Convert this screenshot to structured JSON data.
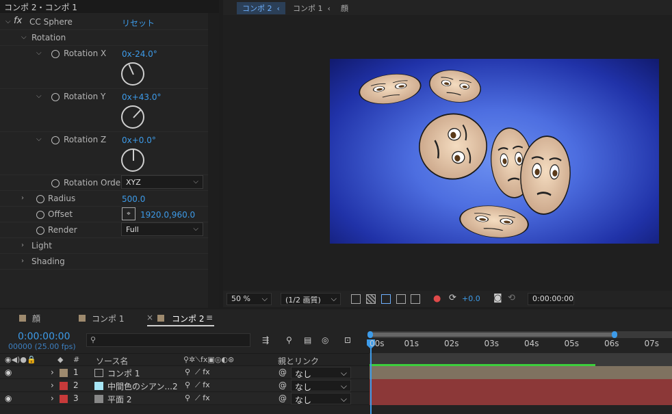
{
  "effects_panel": {
    "title": "コンポ 2・コンポ 1",
    "effect_name": "CC Sphere",
    "reset": "リセット",
    "rotation_group": "Rotation",
    "rotation_x": {
      "label": "Rotation X",
      "value": "0x-24.0°",
      "angle": -24
    },
    "rotation_y": {
      "label": "Rotation Y",
      "value": "0x+43.0°",
      "angle": 43
    },
    "rotation_z": {
      "label": "Rotation Z",
      "value": "0x+0.0°",
      "angle": 0
    },
    "rotation_order": {
      "label": "Rotation Order",
      "value": "XYZ"
    },
    "radius": {
      "label": "Radius",
      "value": "500.0"
    },
    "offset": {
      "label": "Offset",
      "value": "1920.0,960.0"
    },
    "render": {
      "label": "Render",
      "value": "Full"
    },
    "light": "Light",
    "shading": "Shading"
  },
  "comp_tabs": [
    "コンポ 2",
    "コンポ 1",
    "顔"
  ],
  "viewer_toolbar": {
    "zoom": "50 %",
    "resolution": "(1/2 画質)",
    "exposure": "+0.0",
    "timecode": "0:00:00:00"
  },
  "timeline": {
    "tabs": [
      "顔",
      "コンポ 1",
      "コンポ 2"
    ],
    "current_time": "0:00:00:00",
    "frame_info": "00000 (25.00 fps)",
    "columns": {
      "num": "#",
      "source": "ソース名",
      "parent": "親とリンク"
    },
    "layers": [
      {
        "num": "1",
        "name": "コンポ 1",
        "parent": "なし",
        "color": "#9e8a6e"
      },
      {
        "num": "2",
        "name": "中間色のシアン...2",
        "parent": "なし",
        "color": "#c73a3a"
      },
      {
        "num": "3",
        "name": "平面 2",
        "parent": "なし",
        "color": "#c73a3a"
      }
    ],
    "ruler": [
      "00s",
      "01s",
      "02s",
      "03s",
      "04s",
      "05s",
      "06s",
      "07s"
    ]
  }
}
